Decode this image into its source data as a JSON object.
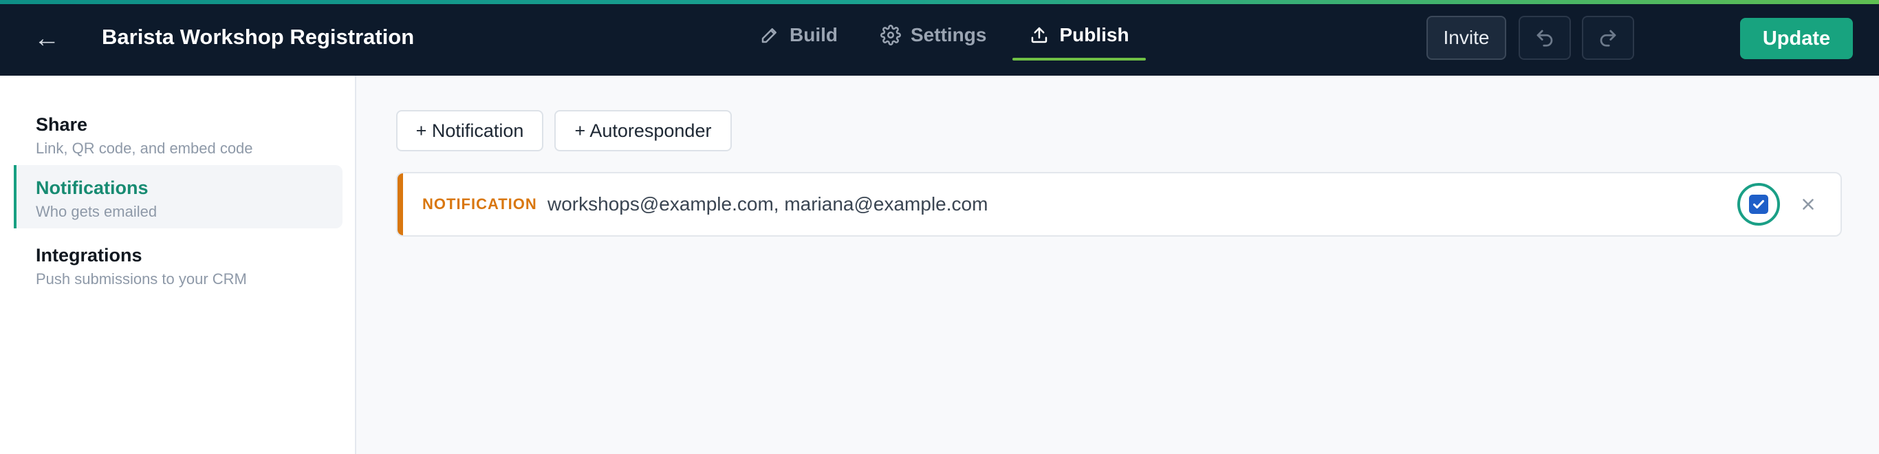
{
  "header": {
    "back_glyph": "←",
    "title": "Barista Workshop Registration",
    "tabs": [
      {
        "label": "Build",
        "icon": "pencil-icon",
        "active": false
      },
      {
        "label": "Settings",
        "icon": "gear-icon",
        "active": false
      },
      {
        "label": "Publish",
        "icon": "upload-icon",
        "active": true
      }
    ],
    "invite_label": "Invite",
    "update_label": "Update"
  },
  "sidebar": {
    "items": [
      {
        "title": "Share",
        "subtitle": "Link, QR code, and embed code",
        "active": false
      },
      {
        "title": "Notifications",
        "subtitle": "Who gets emailed",
        "active": true
      },
      {
        "title": "Integrations",
        "subtitle": "Push submissions to your CRM",
        "active": false
      }
    ]
  },
  "main": {
    "add_notification_label": "+ Notification",
    "add_autoresponder_label": "+ Autoresponder",
    "rules": [
      {
        "type_label": "NOTIFICATION",
        "recipients": "workshops@example.com, mariana@example.com",
        "enabled": true
      }
    ]
  },
  "colors": {
    "header_bg": "#0d1a2b",
    "accent_green": "#18a37f",
    "notification_orange": "#d9770f",
    "active_tab_underline": "#6fc045",
    "checkbox_blue": "#1f5fc8"
  }
}
